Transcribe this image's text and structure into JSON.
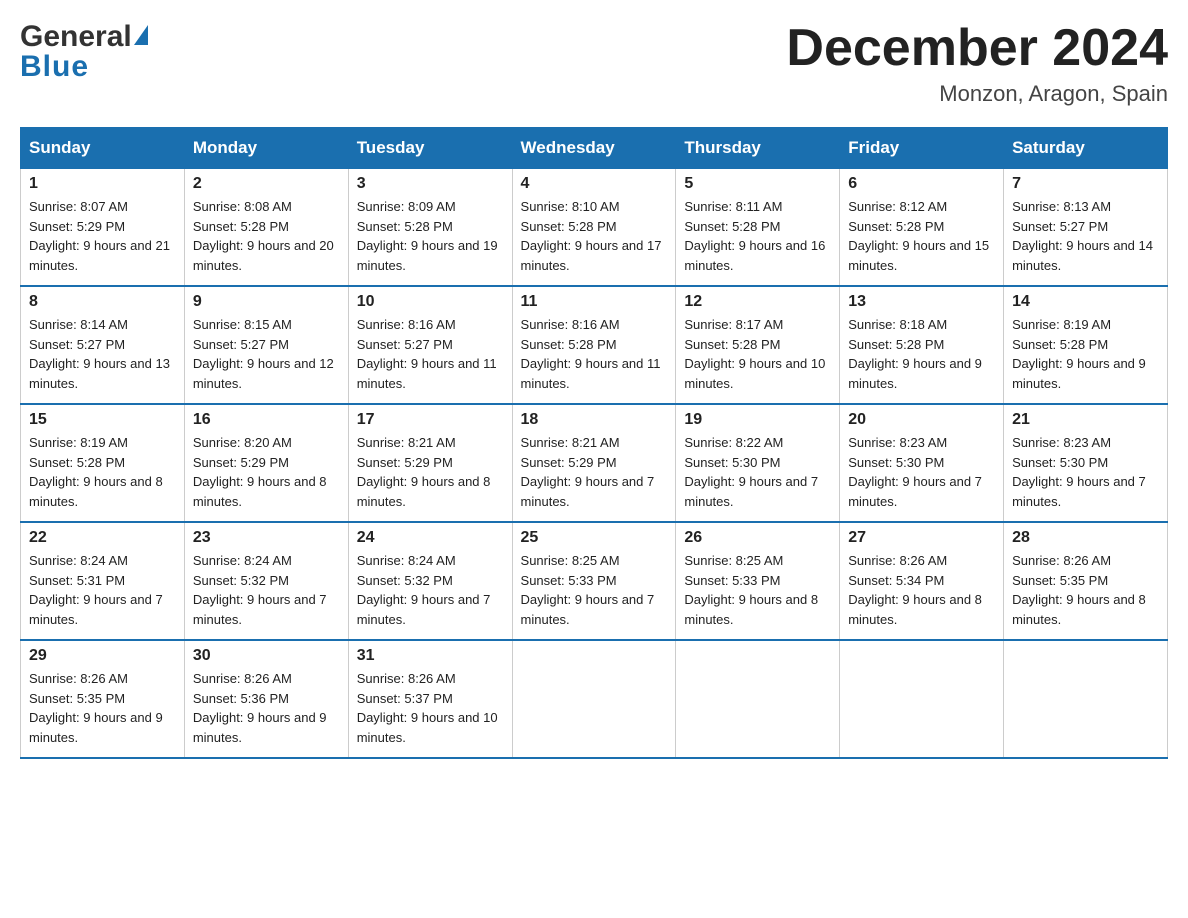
{
  "header": {
    "logo_general": "General",
    "logo_blue": "Blue",
    "title": "December 2024",
    "subtitle": "Monzon, Aragon, Spain"
  },
  "columns": [
    "Sunday",
    "Monday",
    "Tuesday",
    "Wednesday",
    "Thursday",
    "Friday",
    "Saturday"
  ],
  "weeks": [
    [
      {
        "day": "1",
        "sunrise": "Sunrise: 8:07 AM",
        "sunset": "Sunset: 5:29 PM",
        "daylight": "Daylight: 9 hours and 21 minutes."
      },
      {
        "day": "2",
        "sunrise": "Sunrise: 8:08 AM",
        "sunset": "Sunset: 5:28 PM",
        "daylight": "Daylight: 9 hours and 20 minutes."
      },
      {
        "day": "3",
        "sunrise": "Sunrise: 8:09 AM",
        "sunset": "Sunset: 5:28 PM",
        "daylight": "Daylight: 9 hours and 19 minutes."
      },
      {
        "day": "4",
        "sunrise": "Sunrise: 8:10 AM",
        "sunset": "Sunset: 5:28 PM",
        "daylight": "Daylight: 9 hours and 17 minutes."
      },
      {
        "day": "5",
        "sunrise": "Sunrise: 8:11 AM",
        "sunset": "Sunset: 5:28 PM",
        "daylight": "Daylight: 9 hours and 16 minutes."
      },
      {
        "day": "6",
        "sunrise": "Sunrise: 8:12 AM",
        "sunset": "Sunset: 5:28 PM",
        "daylight": "Daylight: 9 hours and 15 minutes."
      },
      {
        "day": "7",
        "sunrise": "Sunrise: 8:13 AM",
        "sunset": "Sunset: 5:27 PM",
        "daylight": "Daylight: 9 hours and 14 minutes."
      }
    ],
    [
      {
        "day": "8",
        "sunrise": "Sunrise: 8:14 AM",
        "sunset": "Sunset: 5:27 PM",
        "daylight": "Daylight: 9 hours and 13 minutes."
      },
      {
        "day": "9",
        "sunrise": "Sunrise: 8:15 AM",
        "sunset": "Sunset: 5:27 PM",
        "daylight": "Daylight: 9 hours and 12 minutes."
      },
      {
        "day": "10",
        "sunrise": "Sunrise: 8:16 AM",
        "sunset": "Sunset: 5:27 PM",
        "daylight": "Daylight: 9 hours and 11 minutes."
      },
      {
        "day": "11",
        "sunrise": "Sunrise: 8:16 AM",
        "sunset": "Sunset: 5:28 PM",
        "daylight": "Daylight: 9 hours and 11 minutes."
      },
      {
        "day": "12",
        "sunrise": "Sunrise: 8:17 AM",
        "sunset": "Sunset: 5:28 PM",
        "daylight": "Daylight: 9 hours and 10 minutes."
      },
      {
        "day": "13",
        "sunrise": "Sunrise: 8:18 AM",
        "sunset": "Sunset: 5:28 PM",
        "daylight": "Daylight: 9 hours and 9 minutes."
      },
      {
        "day": "14",
        "sunrise": "Sunrise: 8:19 AM",
        "sunset": "Sunset: 5:28 PM",
        "daylight": "Daylight: 9 hours and 9 minutes."
      }
    ],
    [
      {
        "day": "15",
        "sunrise": "Sunrise: 8:19 AM",
        "sunset": "Sunset: 5:28 PM",
        "daylight": "Daylight: 9 hours and 8 minutes."
      },
      {
        "day": "16",
        "sunrise": "Sunrise: 8:20 AM",
        "sunset": "Sunset: 5:29 PM",
        "daylight": "Daylight: 9 hours and 8 minutes."
      },
      {
        "day": "17",
        "sunrise": "Sunrise: 8:21 AM",
        "sunset": "Sunset: 5:29 PM",
        "daylight": "Daylight: 9 hours and 8 minutes."
      },
      {
        "day": "18",
        "sunrise": "Sunrise: 8:21 AM",
        "sunset": "Sunset: 5:29 PM",
        "daylight": "Daylight: 9 hours and 7 minutes."
      },
      {
        "day": "19",
        "sunrise": "Sunrise: 8:22 AM",
        "sunset": "Sunset: 5:30 PM",
        "daylight": "Daylight: 9 hours and 7 minutes."
      },
      {
        "day": "20",
        "sunrise": "Sunrise: 8:23 AM",
        "sunset": "Sunset: 5:30 PM",
        "daylight": "Daylight: 9 hours and 7 minutes."
      },
      {
        "day": "21",
        "sunrise": "Sunrise: 8:23 AM",
        "sunset": "Sunset: 5:30 PM",
        "daylight": "Daylight: 9 hours and 7 minutes."
      }
    ],
    [
      {
        "day": "22",
        "sunrise": "Sunrise: 8:24 AM",
        "sunset": "Sunset: 5:31 PM",
        "daylight": "Daylight: 9 hours and 7 minutes."
      },
      {
        "day": "23",
        "sunrise": "Sunrise: 8:24 AM",
        "sunset": "Sunset: 5:32 PM",
        "daylight": "Daylight: 9 hours and 7 minutes."
      },
      {
        "day": "24",
        "sunrise": "Sunrise: 8:24 AM",
        "sunset": "Sunset: 5:32 PM",
        "daylight": "Daylight: 9 hours and 7 minutes."
      },
      {
        "day": "25",
        "sunrise": "Sunrise: 8:25 AM",
        "sunset": "Sunset: 5:33 PM",
        "daylight": "Daylight: 9 hours and 7 minutes."
      },
      {
        "day": "26",
        "sunrise": "Sunrise: 8:25 AM",
        "sunset": "Sunset: 5:33 PM",
        "daylight": "Daylight: 9 hours and 8 minutes."
      },
      {
        "day": "27",
        "sunrise": "Sunrise: 8:26 AM",
        "sunset": "Sunset: 5:34 PM",
        "daylight": "Daylight: 9 hours and 8 minutes."
      },
      {
        "day": "28",
        "sunrise": "Sunrise: 8:26 AM",
        "sunset": "Sunset: 5:35 PM",
        "daylight": "Daylight: 9 hours and 8 minutes."
      }
    ],
    [
      {
        "day": "29",
        "sunrise": "Sunrise: 8:26 AM",
        "sunset": "Sunset: 5:35 PM",
        "daylight": "Daylight: 9 hours and 9 minutes."
      },
      {
        "day": "30",
        "sunrise": "Sunrise: 8:26 AM",
        "sunset": "Sunset: 5:36 PM",
        "daylight": "Daylight: 9 hours and 9 minutes."
      },
      {
        "day": "31",
        "sunrise": "Sunrise: 8:26 AM",
        "sunset": "Sunset: 5:37 PM",
        "daylight": "Daylight: 9 hours and 10 minutes."
      },
      null,
      null,
      null,
      null
    ]
  ]
}
